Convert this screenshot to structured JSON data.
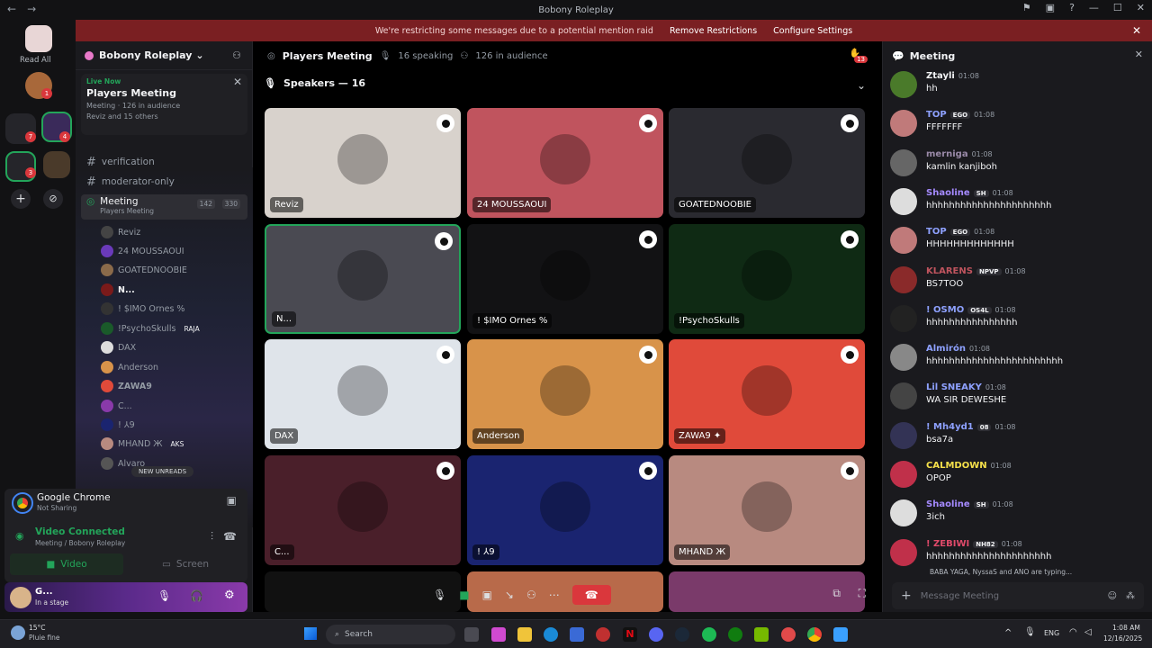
{
  "titlebar": {
    "title": "Bobony Roleplay",
    "back": "←",
    "forward": "→"
  },
  "banner": {
    "text": "We're restricting some messages due to a potential mention raid",
    "remove": "Remove Restrictions",
    "configure": "Configure Settings"
  },
  "guilds": {
    "read_all": "Read All",
    "badge1": "1",
    "badge7": "7",
    "badge4": "4",
    "badge3": "3"
  },
  "server": {
    "name": "Bobony Roleplay"
  },
  "live": {
    "tag": "Live Now",
    "title": "Players Meeting",
    "meta": "Meeting · 126 in audience",
    "sub": "Reviz and 15 others"
  },
  "channels": [
    {
      "name": "verification",
      "icon": "#"
    },
    {
      "name": "moderator-only",
      "icon": "#"
    }
  ],
  "meeting_channel": {
    "name": "Meeting",
    "sub": "Players Meeting",
    "count1": "142",
    "count2": "330"
  },
  "members": [
    "Reviz",
    "24 MOUSSAOUI",
    "GOATEDNOOBIE",
    "N...",
    "! $IMO Ornes %",
    "!PsychoSkulls",
    "DAX",
    "Anderson",
    "ZAWA9",
    "C...",
    "! ⅄9",
    "MHAND Ж",
    "Alvaro"
  ],
  "member_tags": {
    "psycho": "RAJA",
    "mhand": "AKS"
  },
  "new_unreads": "NEW UNREADS",
  "voice": {
    "app": "Google Chrome",
    "app_sub": "Not Sharing",
    "status": "Video Connected",
    "channel": "Meeting / Bobony Roleplay",
    "video": "Video",
    "screen": "Screen"
  },
  "user": {
    "name": "G...",
    "status": "In a stage"
  },
  "stage": {
    "title": "Players Meeting",
    "speaking": "16 speaking",
    "audience": "126 in audience",
    "speakers_label": "Speakers — 16",
    "notif": "13"
  },
  "tiles": [
    {
      "name": "Reviz",
      "bg": "#d8d2cc"
    },
    {
      "name": "24 MOUSSAOUI",
      "bg": "#c0545e"
    },
    {
      "name": "GOATEDNOOBIE",
      "bg": "#2a2a30"
    },
    {
      "name": "N...",
      "bg": "#4a4a52"
    },
    {
      "name": "! $IMO Ornes %",
      "bg": "#121214"
    },
    {
      "name": "!PsychoSkulls",
      "bg": "#0f2a14"
    },
    {
      "name": "DAX",
      "bg": "#dfe4ea"
    },
    {
      "name": "Anderson",
      "bg": "#d8934a"
    },
    {
      "name": "ZAWA9 ✦",
      "bg": "#e04a3a"
    },
    {
      "name": "C...",
      "bg": "#4a1f2a"
    },
    {
      "name": "! ⅄9",
      "bg": "#1a2470"
    },
    {
      "name": "MHAND Ж",
      "bg": "#b88a80"
    }
  ],
  "chat": {
    "title": "Meeting",
    "input_placeholder": "Message Meeting",
    "typing": "BABA YAGA, NyssaS and ANO are typing...",
    "messages": [
      {
        "user": "Ztayli",
        "time": "01:08",
        "text": "hh",
        "color": "#f2f3f5"
      },
      {
        "user": "TOP",
        "time": "01:08",
        "text": "FFFFFFF",
        "color": "#8ea1ff",
        "tag": "EGO"
      },
      {
        "user": "merniga",
        "time": "01:08",
        "text": "kamlin kanjiboh",
        "color": "#9a8aa8"
      },
      {
        "user": "Shaoline",
        "time": "01:08",
        "text": "hhhhhhhhhhhhhhhhhhhhhh",
        "color": "#a58aff",
        "tag": "SH"
      },
      {
        "user": "TOP",
        "time": "01:08",
        "text": "HHHHHHHHHHHHH",
        "color": "#8ea1ff",
        "tag": "EGO"
      },
      {
        "user": "KLARENS",
        "time": "01:08",
        "text": "BS7TOO",
        "color": "#c0545e",
        "tag": "NPVP"
      },
      {
        "user": "! OSMO",
        "time": "01:08",
        "text": "hhhhhhhhhhhhhhhh",
        "color": "#8ea1ff",
        "tag": "OS4L"
      },
      {
        "user": "Almirón",
        "time": "01:08",
        "text": "hhhhhhhhhhhhhhhhhhhhhhhh",
        "color": "#8ea1ff"
      },
      {
        "user": "Lil SNEAKY",
        "time": "01:08",
        "text": "WA SIR DEWESHE",
        "color": "#8ea1ff"
      },
      {
        "user": "! Mh4yd1",
        "time": "01:08",
        "text": "bsa7a",
        "color": "#8ea1ff",
        "tag": "08"
      },
      {
        "user": "CALMDOWN",
        "time": "01:08",
        "text": "OPOP",
        "color": "#f5e04a"
      },
      {
        "user": "Shaoline",
        "time": "01:08",
        "text": "3ich",
        "color": "#a58aff",
        "tag": "SH"
      },
      {
        "user": "! ZEBIWI",
        "time": "01:08",
        "text": "hhhhhhhhhhhhhhhhhhhhhh",
        "color": "#e04a6a",
        "tag": "NH82"
      }
    ]
  },
  "taskbar": {
    "weather": "15°C",
    "weather_sub": "Pluie fine",
    "search": "Search",
    "lang": "ENG",
    "time": "1:08 AM",
    "date": "12/16/2025"
  }
}
